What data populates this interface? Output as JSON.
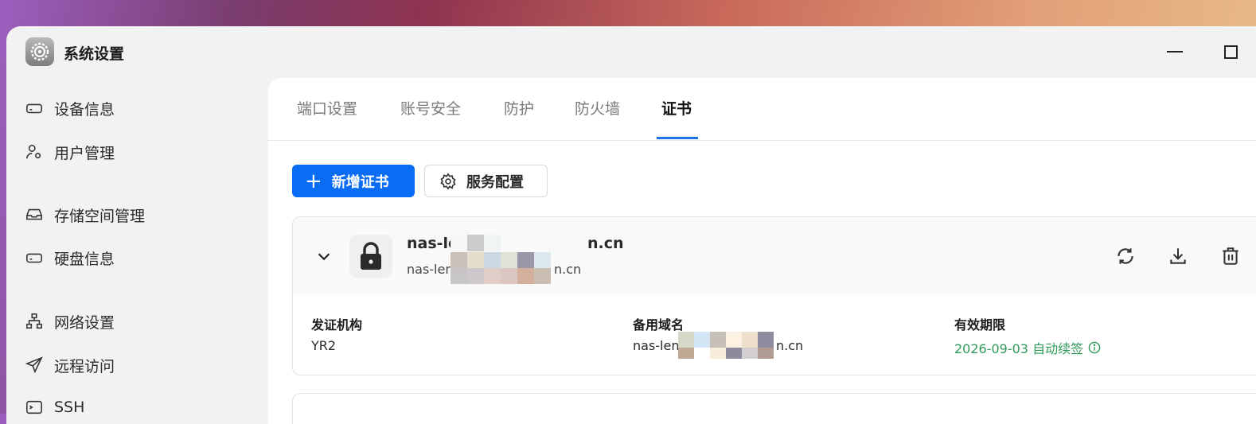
{
  "window": {
    "title": "系统设置"
  },
  "sidebar": {
    "items": [
      {
        "label": "设备信息",
        "icon": "device-icon"
      },
      {
        "label": "用户管理",
        "icon": "user-settings-icon"
      },
      {
        "label": "存储空间管理",
        "icon": "storage-icon"
      },
      {
        "label": "硬盘信息",
        "icon": "disk-icon"
      },
      {
        "label": "网络设置",
        "icon": "network-icon"
      },
      {
        "label": "远程访问",
        "icon": "send-icon"
      },
      {
        "label": "SSH",
        "icon": "terminal-icon"
      }
    ]
  },
  "tabs": [
    {
      "label": "端口设置"
    },
    {
      "label": "账号安全"
    },
    {
      "label": "防护"
    },
    {
      "label": "防火墙"
    },
    {
      "label": "证书",
      "active": true
    }
  ],
  "toolbar": {
    "add_label": "新增证书",
    "config_label": "服务配置"
  },
  "certificate": {
    "name_start": "nas-le",
    "name_end": "n.cn",
    "sub_start": "nas-len",
    "sub_end": "n.cn",
    "issuer_label": "发证机构",
    "issuer_value": "YR2",
    "alt_label": "备用域名",
    "alt_start": "nas-len",
    "alt_end": "n.cn",
    "expiry_label": "有效期限",
    "expiry_value": "2026-09-03 自动续签"
  },
  "colors": {
    "accent": "#0a6cf2",
    "success": "#2f9a5a"
  }
}
